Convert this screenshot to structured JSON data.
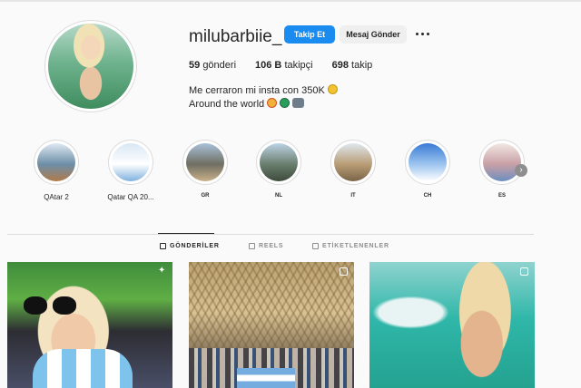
{
  "profile": {
    "username": "milubarbiie_",
    "follow_label": "Takip Et",
    "message_label": "Mesaj Gönder",
    "stats": {
      "posts_count": "59",
      "posts_label": "gönderi",
      "followers_count": "106 B",
      "followers_label": "takipçi",
      "following_count": "698",
      "following_label": "takip"
    },
    "bio_line1": "Me cerraron mi insta con 350K",
    "bio_line2": "Around the world"
  },
  "highlights": [
    {
      "label": "QAtar 2",
      "colors": [
        "#dfe9f2",
        "#6d8fa8",
        "#b07a4a"
      ]
    },
    {
      "label": "Qatar QA 20...",
      "colors": [
        "#d9e7f4",
        "#ffffff",
        "#7fb2de"
      ]
    },
    {
      "label": "GR",
      "colors": [
        "#a9c1d9",
        "#6f6f63",
        "#c9b08a"
      ]
    },
    {
      "label": "NL",
      "colors": [
        "#bcd3e6",
        "#6a7f6e",
        "#3d4a3c"
      ]
    },
    {
      "label": "IT",
      "colors": [
        "#dfe8ef",
        "#b99d76",
        "#7a6448"
      ]
    },
    {
      "label": "CH",
      "colors": [
        "#3a7bd5",
        "#9cc4ef",
        "#ffffff"
      ]
    },
    {
      "label": "ES",
      "colors": [
        "#f1e8e2",
        "#c9a0a6",
        "#6c8fbf"
      ]
    }
  ],
  "tabs": [
    {
      "label": "GÖNDERİLER",
      "active": true
    },
    {
      "label": "REELS",
      "active": false
    },
    {
      "label": "ETİKETLENENLER",
      "active": false
    }
  ],
  "colors": {
    "accent": "#1a8cf0",
    "text": "#262626",
    "muted": "#8e8e8e",
    "background": "#fafafa"
  }
}
